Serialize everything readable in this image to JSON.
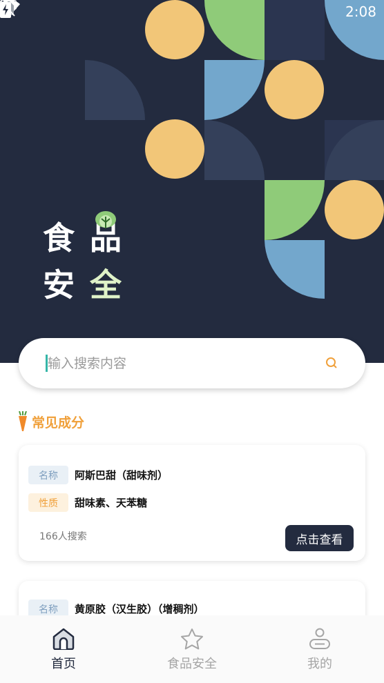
{
  "status_bar": {
    "time": "2:08"
  },
  "hero": {
    "title_chars": [
      "食",
      "品",
      "安",
      "全"
    ],
    "colors": {
      "background": "#232b3f",
      "orange": "#f2c678",
      "green": "#8fcb79",
      "blue": "#73a7cc",
      "dark_tile": "#34405a"
    }
  },
  "search": {
    "placeholder": "输入搜索内容"
  },
  "section": {
    "title": "常见成分"
  },
  "cards": [
    {
      "name_tag": "名称",
      "name": "阿斯巴甜（甜味剂）",
      "prop_tag": "性质",
      "prop": "甜味素、天苯糖",
      "count": "166人搜索",
      "button": "点击查看"
    },
    {
      "name_tag": "名称",
      "name": "黄原胶（汉生胶）（增稠剂）"
    }
  ],
  "tabbar": {
    "items": [
      {
        "label": "首页",
        "icon": "home-icon",
        "active": true
      },
      {
        "label": "食品安全",
        "icon": "star-icon",
        "active": false
      },
      {
        "label": "我的",
        "icon": "profile-icon",
        "active": false
      }
    ]
  },
  "accent": {
    "orange": "#f0a03a",
    "button_bg": "#232b3f"
  }
}
